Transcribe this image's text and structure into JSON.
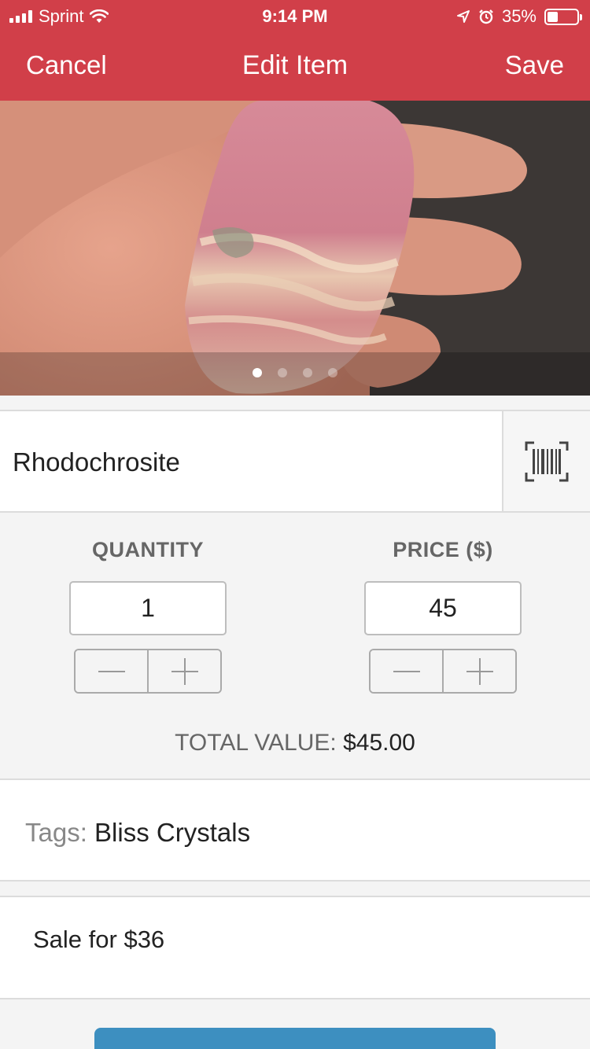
{
  "status_bar": {
    "carrier": "Sprint",
    "time": "9:14 PM",
    "battery_percent": "35%",
    "battery_level": 0.35
  },
  "nav": {
    "cancel_label": "Cancel",
    "title": "Edit Item",
    "save_label": "Save"
  },
  "gallery": {
    "page_count": 4,
    "active_page": 1
  },
  "item": {
    "name": "Rhodochrosite"
  },
  "quantity": {
    "label": "QUANTITY",
    "value": "1"
  },
  "price": {
    "label": "PRICE ($)",
    "value": "45"
  },
  "total": {
    "label": "TOTAL VALUE:",
    "amount": "$45.00"
  },
  "tags": {
    "label": "Tags:",
    "value": "Bliss Crystals"
  },
  "notes": {
    "text": "Sale for $36"
  },
  "colors": {
    "header": "#d13f49",
    "action_blue": "#3d8fc0"
  },
  "icons": {
    "scan": "barcode-icon",
    "minus": "minus-icon",
    "plus": "plus-icon"
  }
}
